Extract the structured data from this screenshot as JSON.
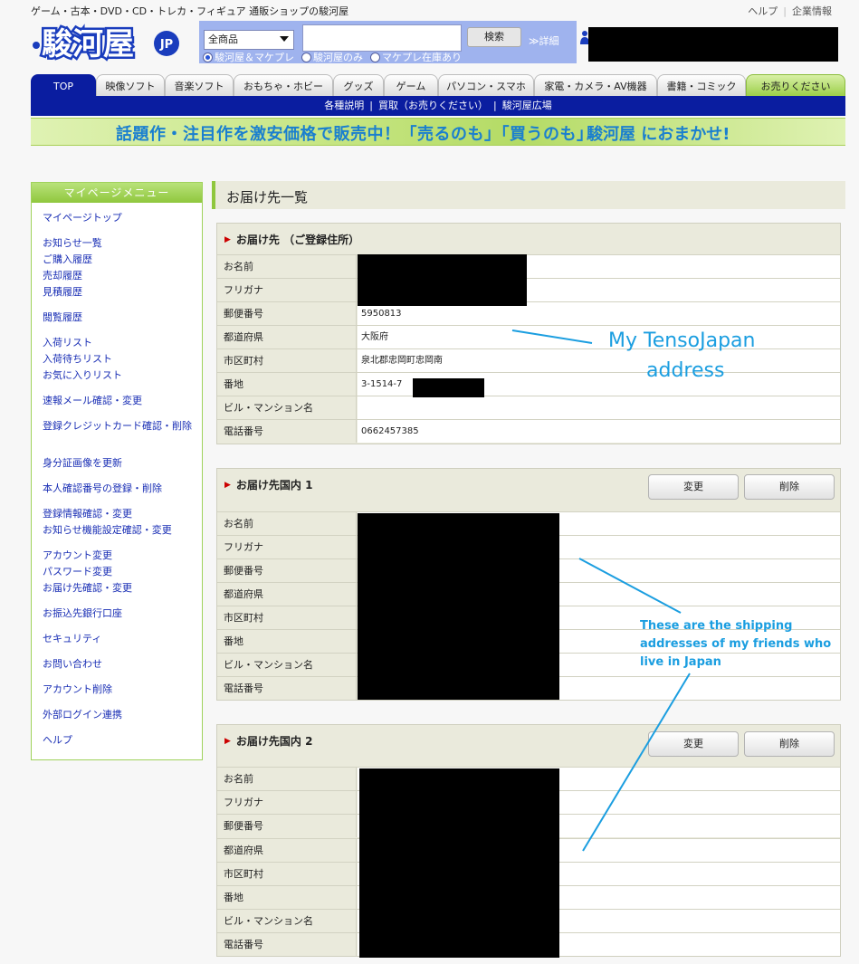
{
  "header": {
    "tagline": "ゲーム・古本・DVD・CD・トレカ・フィギュア 通販ショップの駿河屋",
    "help_link": "ヘルプ",
    "company_link": "企業情報",
    "logo_text": "駿河屋",
    "logo_suffix": "JP"
  },
  "search": {
    "category": "全商品",
    "button": "検索",
    "detail_link": "≫詳細",
    "radio_options": [
      "駿河屋＆マケプレ",
      "駿河屋のみ",
      "マケプレ在庫あり"
    ],
    "radio_selected": "駿河屋＆マケプレ"
  },
  "nav": {
    "tabs": [
      "TOP",
      "映像ソフト",
      "音楽ソフト",
      "おもちゃ・ホビー",
      "グッズ",
      "ゲーム",
      "パソコン・スマホ",
      "家電・カメラ・AV機器",
      "書籍・コミック",
      "お売りください"
    ],
    "subnav": [
      "各種説明",
      "買取（お売りください）",
      "駿河屋広場"
    ]
  },
  "banner": {
    "text": "話題作・注目作を激安価格で販売中！「売るのも」「買うのも」",
    "brand": "駿河屋 におまかせ!"
  },
  "sidemenu": {
    "title": "マイページメニュー",
    "items": [
      "マイページトップ",
      "お知らせ一覧",
      "ご購入履歴",
      "売却履歴",
      "見積履歴",
      "閲覧履歴",
      "入荷リスト",
      "入荷待ちリスト",
      "お気に入りリスト",
      "速報メール確認・変更",
      "登録クレジットカード確認・削除",
      "身分証画像を更新",
      "本人確認番号の登録・削除",
      "登録情報確認・変更",
      "お知らせ機能設定確認・変更",
      "アカウント変更",
      "パスワード変更",
      "お届け先確認・変更",
      "お振込先銀行口座",
      "セキュリティ",
      "お問い合わせ",
      "アカウント削除",
      "外部ログイン連携",
      "ヘルプ"
    ]
  },
  "page": {
    "title": "お届け先一覧"
  },
  "field_labels": [
    "お名前",
    "フリガナ",
    "郵便番号",
    "都道府県",
    "市区町村",
    "番地",
    "ビル・マンション名",
    "電話番号"
  ],
  "addresses": [
    {
      "title": "お届け先 （ご登録住所）",
      "values": [
        "",
        "",
        "5950813",
        "大阪府",
        "泉北郡忠岡町忠岡南",
        "3-1514-7",
        "",
        "0662457385"
      ]
    },
    {
      "title": "お届け先国内 1",
      "edit_button": "変更",
      "delete_button": "削除"
    },
    {
      "title": "お届け先国内 2",
      "edit_button": "変更",
      "delete_button": "削除"
    }
  ],
  "annotations": {
    "tensojapan": [
      "My TensoJapan",
      "address"
    ],
    "friends": [
      "These are the shipping",
      "addresses of my friends who",
      "live in Japan"
    ],
    "color": "#1b9ee0"
  },
  "colors": {
    "nav_blue": "#0a1da0",
    "menu_green": "#8fc73d",
    "link_blue": "#1a2fb5",
    "search_bg": "#9fb3ee"
  }
}
